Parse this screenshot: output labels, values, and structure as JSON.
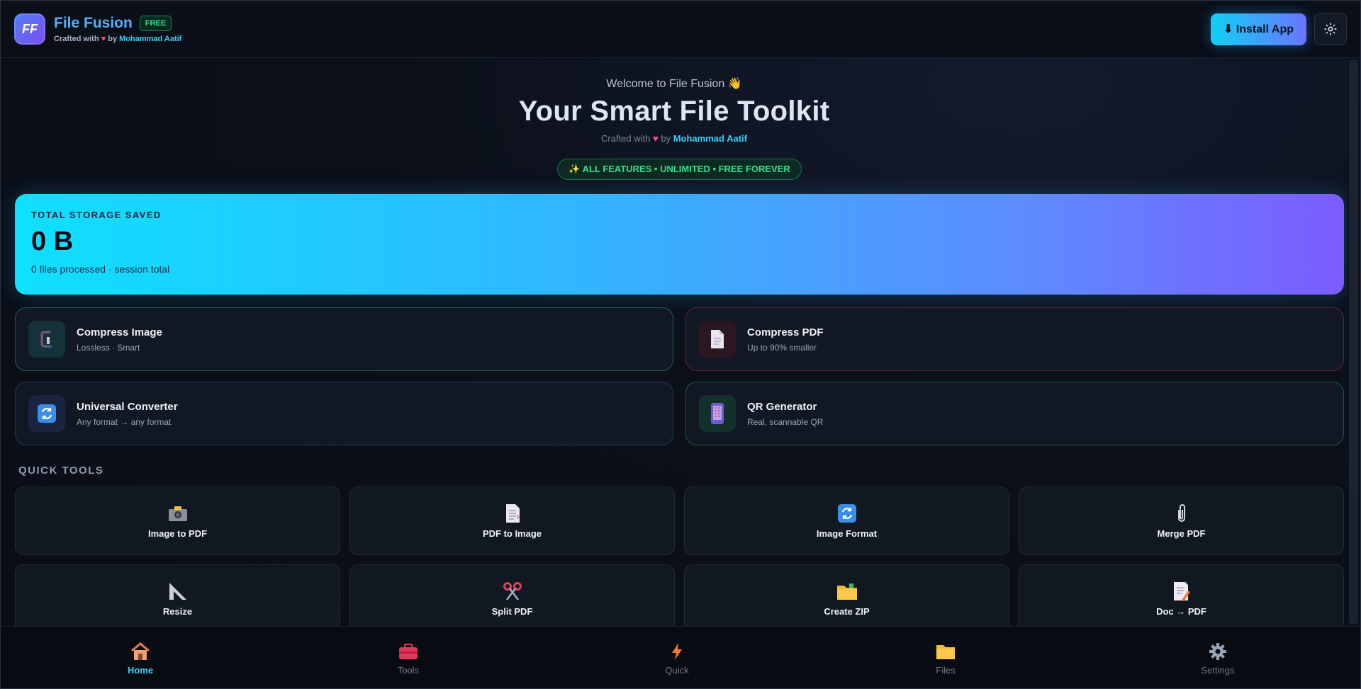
{
  "header": {
    "logo_text": "FF",
    "app_name": "File Fusion",
    "badge": "FREE",
    "crafted": "Crafted with",
    "heart": "♥",
    "by": "by",
    "author": "Mohammad Aatif",
    "install_label": "⬇ Install App",
    "settings_icon": "gear-icon"
  },
  "hero": {
    "welcome": "Welcome to File Fusion 👋",
    "title": "Your Smart File Toolkit",
    "crafted": "Crafted with",
    "heart": "♥",
    "by": "by",
    "author": "Mohammad Aatif",
    "pill": "✨ ALL FEATURES • UNLIMITED • FREE FOREVER"
  },
  "storage": {
    "label": "TOTAL STORAGE SAVED",
    "value": "0 B",
    "note": "0 files processed · session total"
  },
  "features": [
    {
      "title": "Compress Image",
      "subtitle": "Lossless · Smart",
      "icon": "clamp-icon"
    },
    {
      "title": "Compress PDF",
      "subtitle": "Up to 90% smaller",
      "icon": "document-icon"
    },
    {
      "title": "Universal Converter",
      "subtitle": "Any format → any format",
      "icon": "convert-icon"
    },
    {
      "title": "QR Generator",
      "subtitle": "Real, scannable QR",
      "icon": "phone-icon"
    }
  ],
  "quick_tools": {
    "label": "QUICK TOOLS",
    "items": [
      {
        "label": "Image to PDF",
        "icon": "camera-icon"
      },
      {
        "label": "PDF to Image",
        "icon": "page-icon"
      },
      {
        "label": "Image Format",
        "icon": "convert-icon"
      },
      {
        "label": "Merge PDF",
        "icon": "paperclip-icon"
      },
      {
        "label": "Resize",
        "icon": "ruler-triangle-icon"
      },
      {
        "label": "Split PDF",
        "icon": "scissors-icon"
      },
      {
        "label": "Create ZIP",
        "icon": "folder-icon"
      },
      {
        "label": "Doc → PDF",
        "icon": "memo-icon"
      }
    ]
  },
  "nav": {
    "active": "Home",
    "items": [
      {
        "label": "Home",
        "icon": "home-icon"
      },
      {
        "label": "Tools",
        "icon": "toolbox-icon"
      },
      {
        "label": "Quick",
        "icon": "lightning-icon"
      },
      {
        "label": "Files",
        "icon": "folder-icon"
      },
      {
        "label": "Settings",
        "icon": "gear-icon"
      }
    ]
  },
  "colors": {
    "accent": "#38d2f5",
    "free_badge": "#2fe08f",
    "background": "#0a0e17"
  }
}
